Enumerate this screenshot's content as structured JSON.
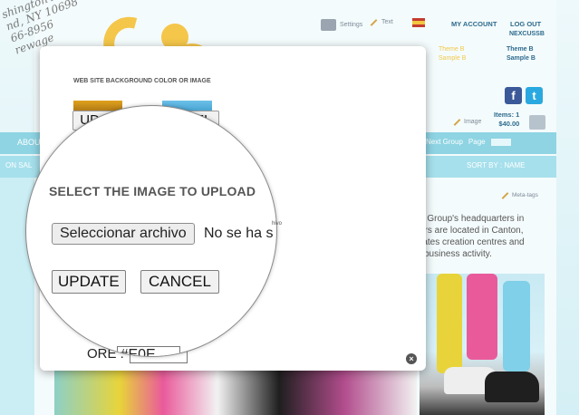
{
  "site": {
    "address_lines": [
      "shington Ave",
      "nd, NY 10698",
      "66-8956",
      "rewage"
    ],
    "top_links": {
      "settings": "Settings",
      "text": "Text"
    },
    "account": {
      "my_account": "MY ACCOUNT",
      "logout": "LOG OUT",
      "username": "NEXCUSSB"
    },
    "themes_left": [
      "Theme B",
      "Sample B"
    ],
    "themes_right": [
      "Theme B",
      "Sample B"
    ],
    "social": {
      "facebook": "f",
      "twitter": "t"
    },
    "image_link": "Image",
    "cart": {
      "items": "Items: 1",
      "total": "$40.00"
    },
    "nav1_left": "ABOU",
    "nav1_right": {
      "next": "Next Group",
      "page": "Page"
    },
    "nav2_left": "ON SAL",
    "nav2_right": "SORT BY : NAME",
    "metatags": "Meta-tags",
    "body_lines": [
      "e Group's headquarters in",
      "ers are located in Canton,",
      "rates creation centres and",
      "l business activity."
    ]
  },
  "modal": {
    "title": "WEB SITE BACKGROUND COLOR OR IMAGE",
    "update_label": "UDATE",
    "cancel_label": "CANCEL",
    "color_label": "ORE :",
    "color_value": "#E0E",
    "close": "×"
  },
  "magnifier": {
    "title": "SELECT THE IMAGE TO UPLOAD",
    "file_button": "Seleccionar archivo",
    "file_status": "No se ha s",
    "file_status_small": "hivo",
    "update_label": "UPDATE",
    "cancel_label": "CANCEL",
    "color_label": "ORE :",
    "color_value": "#E0E"
  }
}
